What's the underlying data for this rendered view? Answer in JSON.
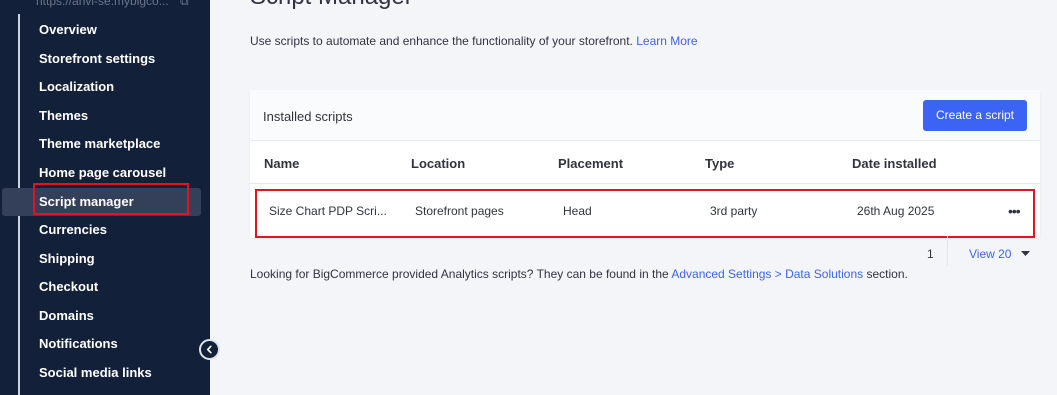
{
  "sidebar": {
    "store_url": "https://anvi-se.mybigco...",
    "items": [
      {
        "label": "Overview"
      },
      {
        "label": "Storefront settings"
      },
      {
        "label": "Localization"
      },
      {
        "label": "Themes"
      },
      {
        "label": "Theme marketplace"
      },
      {
        "label": "Home page carousel"
      },
      {
        "label": "Script manager",
        "active": true
      },
      {
        "label": "Currencies"
      },
      {
        "label": "Shipping"
      },
      {
        "label": "Checkout"
      },
      {
        "label": "Domains"
      },
      {
        "label": "Notifications"
      },
      {
        "label": "Social media links"
      }
    ]
  },
  "main": {
    "title": "Script Manager",
    "intro": "Use scripts to automate and enhance the functionality of your storefront.",
    "intro_link": "Learn More",
    "card": {
      "title": "Installed scripts",
      "create_button": "Create a script",
      "columns": [
        "Name",
        "Location",
        "Placement",
        "Type",
        "Date installed"
      ],
      "rows": [
        {
          "name": "Size Chart PDP Scri...",
          "location": "Storefront pages",
          "placement": "Head",
          "type": "3rd party",
          "date": "26th Aug 2025"
        }
      ]
    },
    "pager": {
      "page": "1",
      "view": "View 20"
    },
    "footer": {
      "text_before": "Looking for BigCommerce provided Analytics scripts? They can be found in the ",
      "link": "Advanced Settings > Data Solutions",
      "text_after": " section."
    }
  },
  "colors": {
    "sidebar_bg": "#13203a",
    "accent": "#3c64f4",
    "highlight": "#e3141f"
  }
}
